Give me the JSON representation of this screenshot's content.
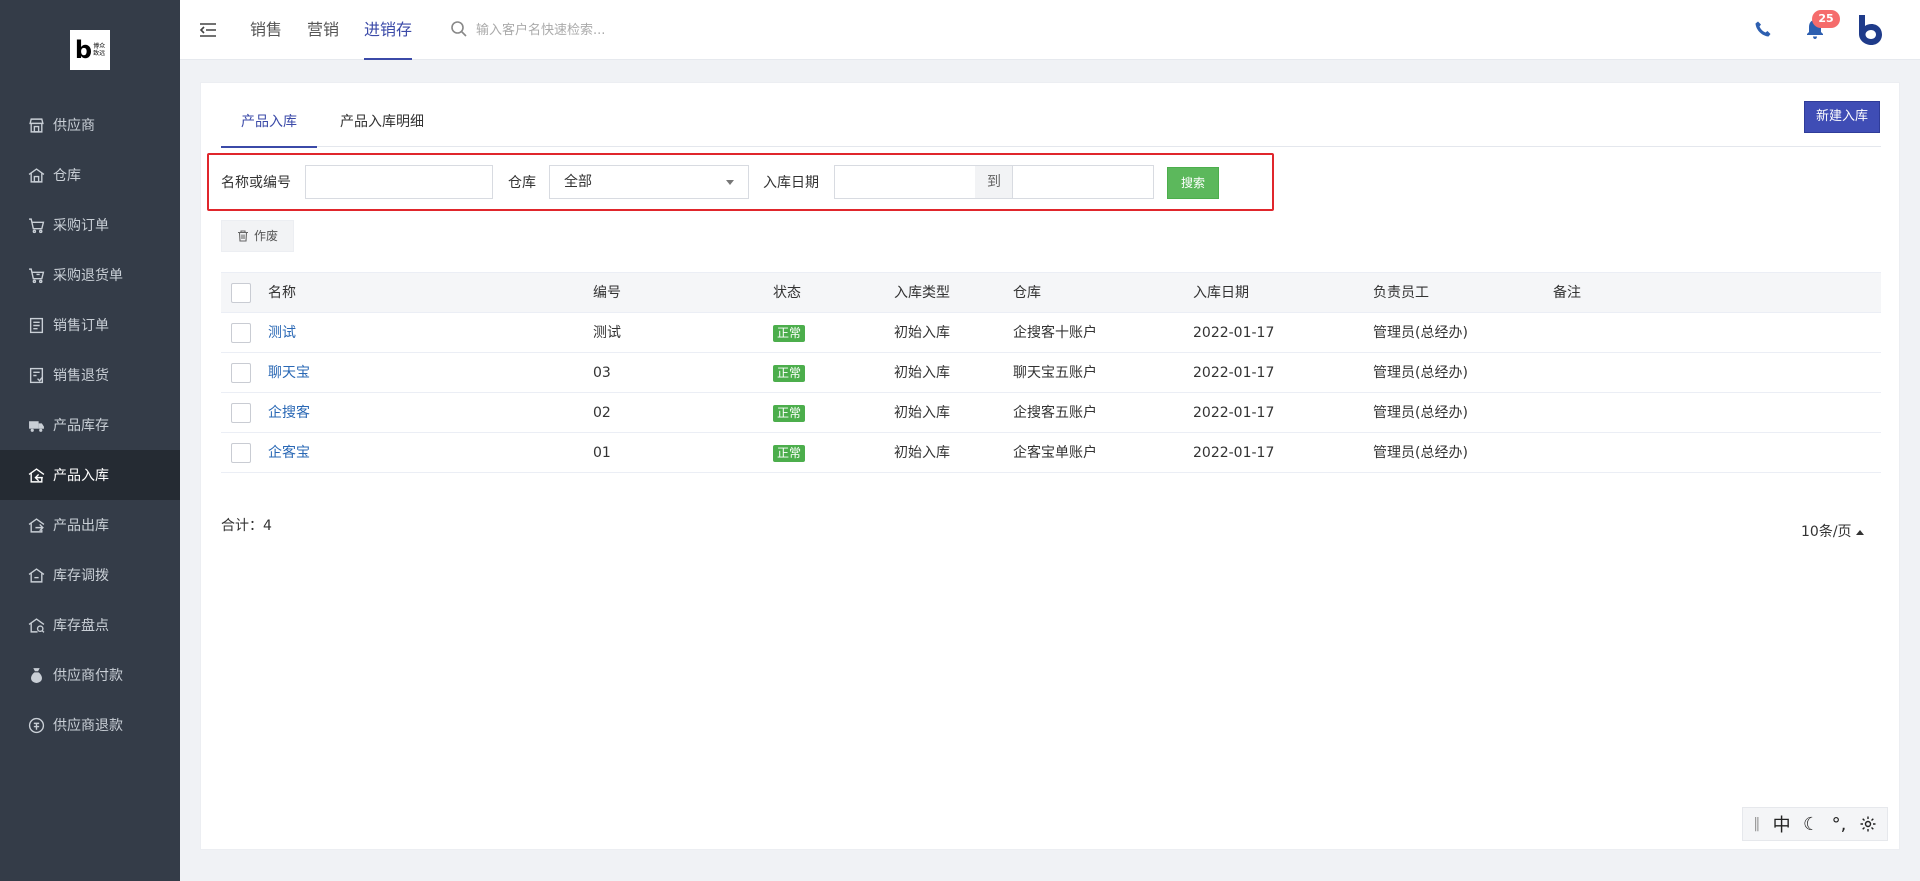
{
  "sidebar": {
    "logo_text_1": "博众",
    "logo_text_2": "致远",
    "items": [
      {
        "label": "供应商",
        "icon": "supplier-icon"
      },
      {
        "label": "仓库",
        "icon": "warehouse-icon"
      },
      {
        "label": "采购订单",
        "icon": "cart-icon"
      },
      {
        "label": "采购退货单",
        "icon": "return-cart-icon"
      },
      {
        "label": "销售订单",
        "icon": "list-icon"
      },
      {
        "label": "销售退货",
        "icon": "return-doc-icon"
      },
      {
        "label": "产品库存",
        "icon": "truck-icon"
      },
      {
        "label": "产品入库",
        "icon": "inbound-icon",
        "active": true
      },
      {
        "label": "产品出库",
        "icon": "outbound-icon"
      },
      {
        "label": "库存调拨",
        "icon": "transfer-icon"
      },
      {
        "label": "库存盘点",
        "icon": "inventory-check-icon"
      },
      {
        "label": "供应商付款",
        "icon": "money-bag-icon"
      },
      {
        "label": "供应商退款",
        "icon": "refund-icon"
      }
    ]
  },
  "header": {
    "tabs": [
      "销售",
      "营销",
      "进销存"
    ],
    "active_tab": "进销存",
    "search_placeholder": "输入客户名快速检索...",
    "notification_count": "25"
  },
  "page": {
    "tabs": [
      "产品入库",
      "产品入库明细"
    ],
    "new_button": "新建入库",
    "filters": {
      "name_label": "名称或编号",
      "name_value": "",
      "warehouse_label": "仓库",
      "warehouse_value": "全部",
      "date_label": "入库日期",
      "date_to": "到",
      "search_button": "搜索"
    },
    "void_button": "作废",
    "table": {
      "columns": [
        "名称",
        "编号",
        "状态",
        "入库类型",
        "仓库",
        "入库日期",
        "负责员工",
        "备注"
      ],
      "rows": [
        {
          "name": "测试",
          "code": "测试",
          "status": "正常",
          "type": "初始入库",
          "warehouse": "企搜客十账户",
          "date": "2022-01-17",
          "staff": "管理员(总经办)",
          "remark": ""
        },
        {
          "name": "聊天宝",
          "code": "03",
          "status": "正常",
          "type": "初始入库",
          "warehouse": "聊天宝五账户",
          "date": "2022-01-17",
          "staff": "管理员(总经办)",
          "remark": ""
        },
        {
          "name": "企搜客",
          "code": "02",
          "status": "正常",
          "type": "初始入库",
          "warehouse": "企搜客五账户",
          "date": "2022-01-17",
          "staff": "管理员(总经办)",
          "remark": ""
        },
        {
          "name": "企客宝",
          "code": "01",
          "status": "正常",
          "type": "初始入库",
          "warehouse": "企客宝单账户",
          "date": "2022-01-17",
          "staff": "管理员(总经办)",
          "remark": ""
        }
      ]
    },
    "total_text": "合计：4",
    "page_size": "10条/页"
  },
  "ime": {
    "lang": "中",
    "punct": "°,"
  },
  "colors": {
    "sidebar_bg": "#343c48",
    "accent": "#3b4aa8",
    "success": "#5cb85c",
    "highlight_border": "#e0262c"
  }
}
